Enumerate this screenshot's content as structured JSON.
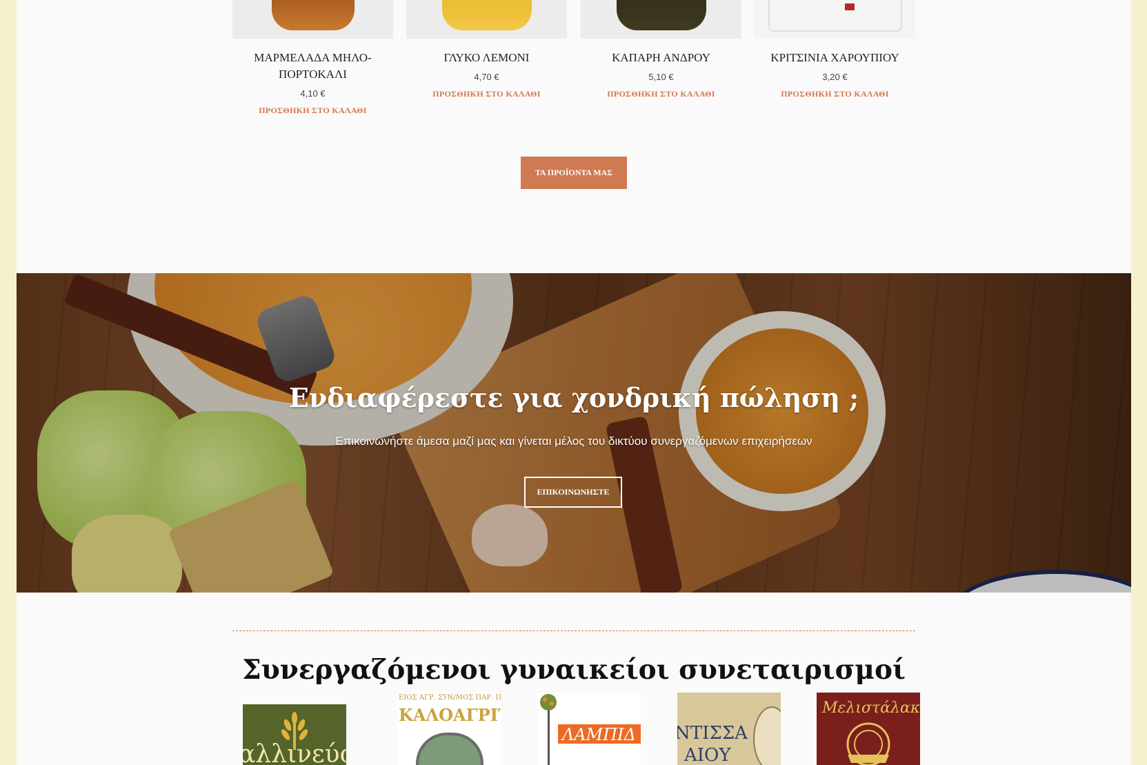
{
  "products": [
    {
      "name": "ΜΑΡΜΕΛΑΔΑ ΜΗΛΟ-ΠΟΡΤΟΚΑΛΙ",
      "price": "4,10 €",
      "cart_label": "ΠΡΟΣΘΗΚΗ ΣΤΟ ΚΑΛΑΘΙ"
    },
    {
      "name": "ΓΛΥΚΟ ΛΕΜΟΝΙ",
      "price": "4,70 €",
      "cart_label": "ΠΡΟΣΘΗΚΗ ΣΤΟ ΚΑΛΑΘΙ"
    },
    {
      "name": "ΚΑΠΑΡΗ ΑΝΔΡΟΥ",
      "price": "5,10 €",
      "cart_label": "ΠΡΟΣΘΗΚΗ ΣΤΟ ΚΑΛΑΘΙ"
    },
    {
      "name": "ΚΡΙΤΣΙΝΙΑ ΧΑΡΟΥΠΙΟΥ",
      "price": "3,20 €",
      "cart_label": "ΠΡΟΣΘΗΚΗ ΣΤΟ ΚΑΛΑΘΙ"
    }
  ],
  "products_button": "ΤΑ ΠΡΟΪΟΝΤΑ ΜΑΣ",
  "banner": {
    "title": "Ενδιαφέρεστε για χονδρική πώληση ;",
    "subtitle": "Επικοινωνήστε άμεσα μαζί μας και γίνεται μέλος του δικτύου συνεργαζόμενων επιχειρήσεων",
    "button": "ΕΠΙΚΟΙΝΩΝΗΣΤΕ"
  },
  "partners": {
    "title": "Συνεργαζόμενοι γυναικείοι συνεταιρισμοί",
    "logos": [
      {
        "text": "αλλινεύσι",
        "icon": "wheat-icon"
      },
      {
        "text": "ΚΑΛΟΑΓΡΙΤΙΣ",
        "top_text": "ΕΙΟΣ ΑΓΡ. ΣΥΝ/ΜΟΣ ΠΑΡ. ΠΡΟΪ"
      },
      {
        "text": "ΛΑΜΠΙΔ",
        "icon": "orange-tree-icon"
      },
      {
        "text": "ΝΤΙΣΣΑ",
        "text2": "ΑΙΟΥ"
      },
      {
        "text": "Μελιστάλακτη",
        "icon": "bee-emblem-icon"
      }
    ]
  },
  "colors": {
    "accent": "#cf7a52",
    "page_background": "#fafafa",
    "outer_background": "#f5f1cf"
  }
}
